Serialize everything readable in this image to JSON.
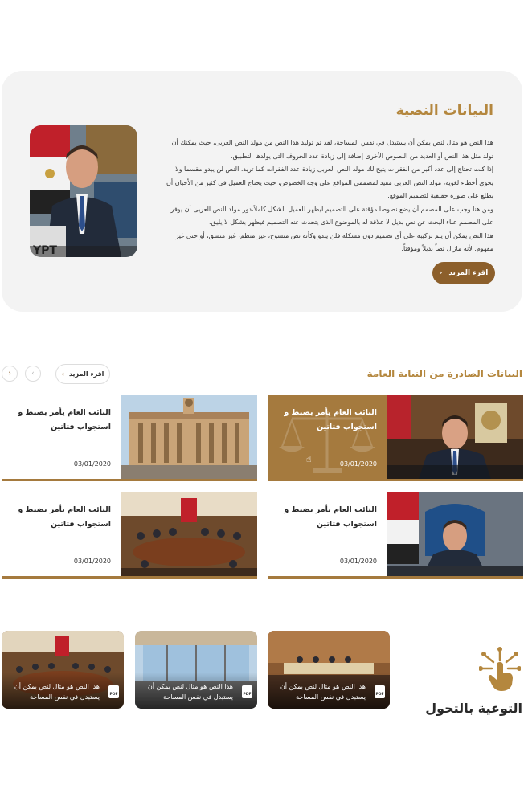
{
  "hero": {
    "title": "البيانات النصية",
    "paragraphs": [
      "هذا النص هو مثال لنص يمكن أن يستبدل في نفس المساحة، لقد تم توليد هذا النص من مولد النص العربى، حيث يمكنك أن تولد مثل هذا النص أو العديد من النصوص الأخرى إضافة إلى زيادة عدد الحروف التى يولدها التطبيق.",
      "إذا كنت تحتاج إلى عدد أكبر من الفقرات يتيح لك مولد النص العربى زيادة عدد الفقرات كما تريد، النص لن يبدو مقسما ولا يحوي أخطاء لغوية، مولد النص العربى مفيد لمصممي المواقع على وجه الخصوص، حيث يحتاج العميل فى كثير من الأحيان أن يطلع على صورة حقيقية لتصميم الموقع.",
      "ومن هنا وجب على المصمم أن يضع نصوصا مؤقتة على التصميم ليظهر للعميل الشكل كاملاً،دور مولد النص العربى أن يوفر على المصمم عناء البحث عن نص بديل لا علاقة له بالموضوع الذى يتحدث عنه التصميم فيظهر بشكل لا يليق.",
      "هذا النص يمكن أن يتم تركيبه على أي تصميم دون مشكلة فلن يبدو وكأنه نص منسوخ، غير منظم، غير منسق، أو حتى غير مفهوم. لأنه مازال نصاً بديلاً ومؤقتاً."
    ],
    "read_more": "اقرء المزيد",
    "photo_label": "YPT"
  },
  "statements": {
    "title": "البيانات الصادرة من النيابة العامة",
    "read_more": "اقرء المزيد",
    "cards": [
      {
        "title": "النائب العام يأمر بضبط و استجواب فتاتين",
        "date": "03/01/2020"
      },
      {
        "title": "النائب العام يأمر بضبط و استجواب فتاتين",
        "date": "03/01/2020"
      },
      {
        "title": "النائب العام يأمر بضبط و استجواب فتاتين",
        "date": "03/01/2020"
      },
      {
        "title": "النائب العام يأمر بضبط و استجواب فتاتين",
        "date": "03/01/2020"
      }
    ]
  },
  "awareness": {
    "title": "التوعية بالتحول",
    "pdf_label": "PDF",
    "items": [
      {
        "text": "هذا النص هو مثال لنص يمكن أن يستبدل في نفس المساحة"
      },
      {
        "text": "هذا النص هو مثال لنص يمكن أن يستبدل في نفس المساحة"
      },
      {
        "text": "هذا النص هو مثال لنص يمكن أن يستبدل في نفس المساحة"
      }
    ]
  },
  "colors": {
    "gold": "#b4873e",
    "brown": "#8c5f2b",
    "panel": "#f3f3f3"
  }
}
